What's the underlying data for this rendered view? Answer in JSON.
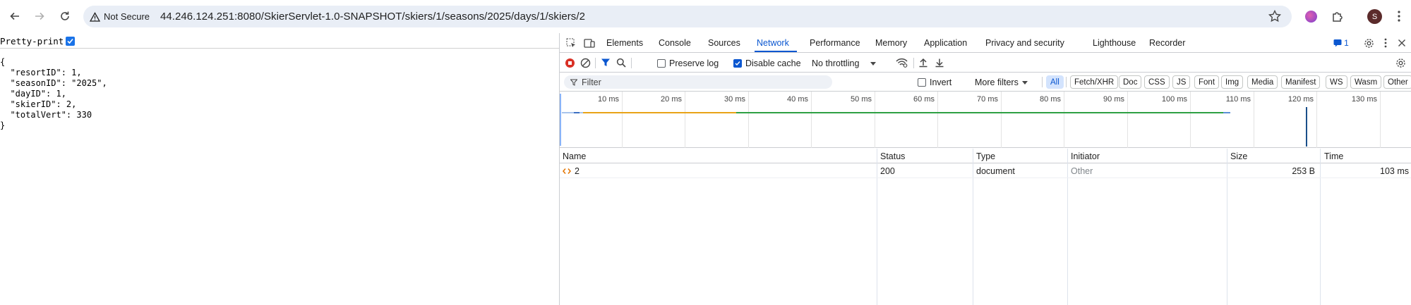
{
  "browser": {
    "security_label": "Not Secure",
    "url": "44.246.124.251:8080/SkierServlet-1.0-SNAPSHOT/skiers/1/seasons/2025/days/1/skiers/2",
    "profile_initial": "S"
  },
  "page": {
    "pretty_print_label": "Pretty-print",
    "json_lines": [
      "{",
      "  \"resortID\": 1,",
      "  \"seasonID\": \"2025\",",
      "  \"dayID\": 1,",
      "  \"skierID\": 2,",
      "  \"totalVert\": 330",
      "}"
    ]
  },
  "devtools": {
    "tabs": [
      "Elements",
      "Console",
      "Sources",
      "Network",
      "Performance",
      "Memory",
      "Application",
      "Privacy and security",
      "Lighthouse",
      "Recorder"
    ],
    "active_tab": "Network",
    "issues_count": "1",
    "network_toolbar": {
      "preserve_log": "Preserve log",
      "disable_cache": "Disable cache",
      "throttling": "No throttling"
    },
    "filter_bar": {
      "placeholder": "Filter",
      "invert": "Invert",
      "more_filters": "More filters",
      "types": [
        "All",
        "Fetch/XHR",
        "Doc",
        "CSS",
        "JS",
        "Font",
        "Img",
        "Media",
        "Manifest",
        "WS",
        "Wasm",
        "Other"
      ],
      "active_type": "All"
    },
    "overview": {
      "ticks": [
        "10 ms",
        "20 ms",
        "30 ms",
        "40 ms",
        "50 ms",
        "60 ms",
        "70 ms",
        "80 ms",
        "90 ms",
        "100 ms",
        "110 ms",
        "120 ms",
        "130 ms"
      ],
      "colors": {
        "waiting": "#e8a317",
        "download": "#2ea043",
        "connect": "#5b8fd6",
        "marker": "#1a4f8a"
      }
    },
    "table": {
      "columns": [
        "Name",
        "Status",
        "Type",
        "Initiator",
        "Size",
        "Time"
      ],
      "rows": [
        {
          "name": "2",
          "status": "200",
          "type": "document",
          "initiator": "Other",
          "size": "253 B",
          "time": "103 ms"
        }
      ]
    }
  }
}
